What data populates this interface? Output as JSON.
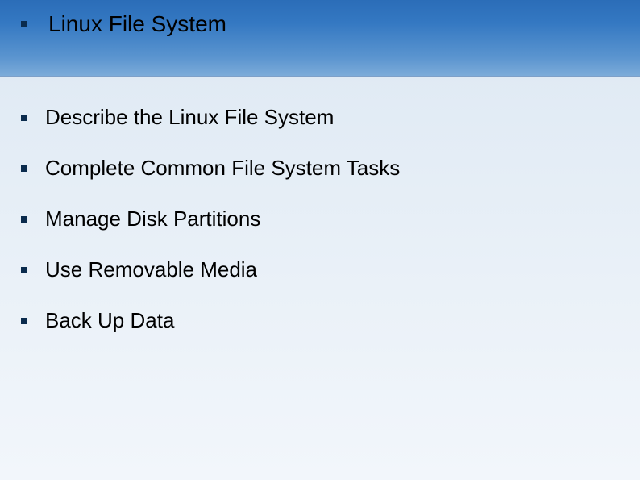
{
  "title": "Linux File System",
  "items": [
    "Describe the Linux File System",
    "Complete Common File System Tasks",
    "Manage Disk Partitions",
    "Use Removable Media",
    "Back Up Data"
  ],
  "colors": {
    "header_gradient_top": "#2b6db8",
    "header_gradient_bottom": "#7cabd9",
    "body_background": "#eaf1f8",
    "bullet": "#0a2b4d"
  }
}
